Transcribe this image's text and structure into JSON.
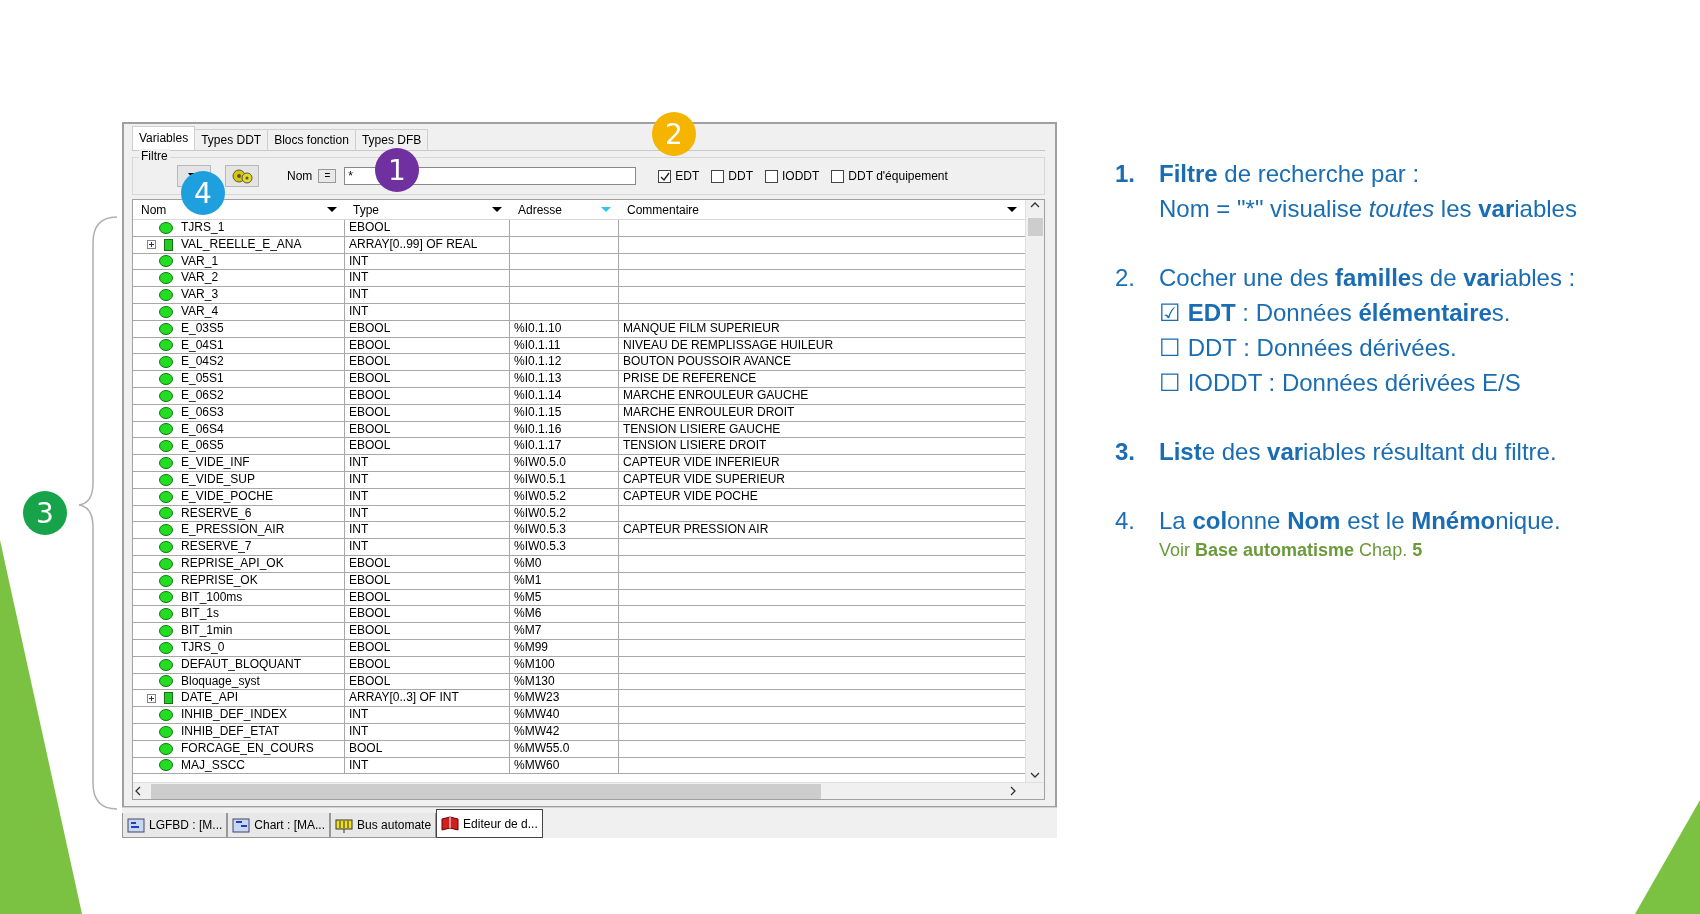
{
  "window": {
    "tabs": [
      {
        "label": "Variables",
        "selected": true
      },
      {
        "label": "Types DDT",
        "selected": false
      },
      {
        "label": "Blocs fonction",
        "selected": false
      },
      {
        "label": "Types DFB",
        "selected": false
      }
    ],
    "filter": {
      "label": "Filtre",
      "name_label": "Nom",
      "operator": "=",
      "value": "*",
      "families": [
        {
          "label": "EDT",
          "checked": true
        },
        {
          "label": "DDT",
          "checked": false
        },
        {
          "label": "IODDT",
          "checked": false
        },
        {
          "label": "DDT d'équipement",
          "checked": false
        }
      ]
    },
    "table": {
      "columns": [
        {
          "label": "Nom",
          "sorted": false
        },
        {
          "label": "Type",
          "sorted": false
        },
        {
          "label": "Adresse",
          "sorted": true
        },
        {
          "label": "Commentaire",
          "sorted": false
        }
      ],
      "rows": [
        {
          "kind": "variable",
          "name": "TJRS_1",
          "type": "EBOOL"
        },
        {
          "kind": "array",
          "name": "VAL_REELLE_E_ANA",
          "type": "ARRAY[0..99] OF REAL"
        },
        {
          "kind": "variable",
          "name": "VAR_1",
          "type": "INT"
        },
        {
          "kind": "variable",
          "name": "VAR_2",
          "type": "INT"
        },
        {
          "kind": "variable",
          "name": "VAR_3",
          "type": "INT"
        },
        {
          "kind": "variable",
          "name": "VAR_4",
          "type": "INT"
        },
        {
          "kind": "variable",
          "name": "E_03S5",
          "type": "EBOOL",
          "address": "%I0.1.10",
          "comment": "MANQUE FILM SUPERIEUR"
        },
        {
          "kind": "variable",
          "name": "E_04S1",
          "type": "EBOOL",
          "address": "%I0.1.11",
          "comment": "NIVEAU DE REMPLISSAGE HUILEUR"
        },
        {
          "kind": "variable",
          "name": "E_04S2",
          "type": "EBOOL",
          "address": "%I0.1.12",
          "comment": "BOUTON POUSSOIR AVANCE"
        },
        {
          "kind": "variable",
          "name": "E_05S1",
          "type": "EBOOL",
          "address": "%I0.1.13",
          "comment": "PRISE DE REFERENCE"
        },
        {
          "kind": "variable",
          "name": "E_06S2",
          "type": "EBOOL",
          "address": "%I0.1.14",
          "comment": "MARCHE ENROULEUR GAUCHE"
        },
        {
          "kind": "variable",
          "name": "E_06S3",
          "type": "EBOOL",
          "address": "%I0.1.15",
          "comment": "MARCHE ENROULEUR DROIT"
        },
        {
          "kind": "variable",
          "name": "E_06S4",
          "type": "EBOOL",
          "address": "%I0.1.16",
          "comment": "TENSION LISIERE GAUCHE"
        },
        {
          "kind": "variable",
          "name": "E_06S5",
          "type": "EBOOL",
          "address": "%I0.1.17",
          "comment": "TENSION LISIERE DROIT"
        },
        {
          "kind": "variable",
          "name": "E_VIDE_INF",
          "type": "INT",
          "address": "%IW0.5.0",
          "comment": "CAPTEUR VIDE INFERIEUR"
        },
        {
          "kind": "variable",
          "name": "E_VIDE_SUP",
          "type": "INT",
          "address": "%IW0.5.1",
          "comment": "CAPTEUR VIDE SUPERIEUR"
        },
        {
          "kind": "variable",
          "name": "E_VIDE_POCHE",
          "type": "INT",
          "address": "%IW0.5.2",
          "comment": "CAPTEUR VIDE POCHE"
        },
        {
          "kind": "variable",
          "name": "RESERVE_6",
          "type": "INT",
          "address": "%IW0.5.2"
        },
        {
          "kind": "variable",
          "name": "E_PRESSION_AIR",
          "type": "INT",
          "address": "%IW0.5.3",
          "comment": "CAPTEUR PRESSION AIR"
        },
        {
          "kind": "variable",
          "name": "RESERVE_7",
          "type": "INT",
          "address": "%IW0.5.3"
        },
        {
          "kind": "variable",
          "name": "REPRISE_API_OK",
          "type": "EBOOL",
          "address": "%M0"
        },
        {
          "kind": "variable",
          "name": "REPRISE_OK",
          "type": "EBOOL",
          "address": "%M1"
        },
        {
          "kind": "variable",
          "name": "BIT_100ms",
          "type": "EBOOL",
          "address": "%M5"
        },
        {
          "kind": "variable",
          "name": "BIT_1s",
          "type": "EBOOL",
          "address": "%M6"
        },
        {
          "kind": "variable",
          "name": "BIT_1min",
          "type": "EBOOL",
          "address": "%M7"
        },
        {
          "kind": "variable",
          "name": "TJRS_0",
          "type": "EBOOL",
          "address": "%M99"
        },
        {
          "kind": "variable",
          "name": "DEFAUT_BLOQUANT",
          "type": "EBOOL",
          "address": "%M100"
        },
        {
          "kind": "variable",
          "name": "Bloquage_syst",
          "type": "EBOOL",
          "address": "%M130"
        },
        {
          "kind": "array",
          "name": "DATE_API",
          "type": "ARRAY[0..3] OF INT",
          "address": "%MW23"
        },
        {
          "kind": "variable",
          "name": "INHIB_DEF_INDEX",
          "type": "INT",
          "address": "%MW40"
        },
        {
          "kind": "variable",
          "name": "INHIB_DEF_ETAT",
          "type": "INT",
          "address": "%MW42"
        },
        {
          "kind": "variable",
          "name": "FORCAGE_EN_COURS",
          "type": "BOOL",
          "address": "%MW55.0"
        },
        {
          "kind": "variable",
          "name": "MAJ_SSCC",
          "type": "INT",
          "address": "%MW60"
        }
      ]
    },
    "taskbar": [
      {
        "label": "LGFBD : [M...",
        "selected": false
      },
      {
        "label": "Chart : [MA...",
        "selected": false
      },
      {
        "label": "Bus automate",
        "selected": false
      },
      {
        "label": "Editeur de d...",
        "selected": true
      }
    ]
  },
  "callouts": [
    {
      "label": "1",
      "color": "#7030a0"
    },
    {
      "label": "2",
      "color": "#f5b400"
    },
    {
      "label": "3",
      "color": "#16a34a"
    },
    {
      "label": "4",
      "color": "#1ea0df"
    }
  ],
  "notes": [
    {
      "number": "1.",
      "emphasis": true,
      "lines": [
        "**Filtre** de recherche par :",
        "Nom = \"*\" visualise *toutes* les **var**iables"
      ]
    },
    {
      "number": "2.",
      "emphasis": false,
      "lines": [
        "Cocher une des **famille**s de **var**iables :",
        "☑ **EDT** : Données **élémentaire**s.",
        "☐ DDT : Données dérivées.",
        "☐ IODDT : Données dérivées E/S"
      ]
    },
    {
      "number": "3.",
      "emphasis": true,
      "lines": [
        "**List**e des **var**iables résultant du filtre."
      ]
    },
    {
      "number": "4.",
      "emphasis": false,
      "lines": [
        "La **col**onne **Nom** est le **Mnémo**nique."
      ],
      "reference": "Voir **Base automatisme** Chap. **5**"
    }
  ]
}
